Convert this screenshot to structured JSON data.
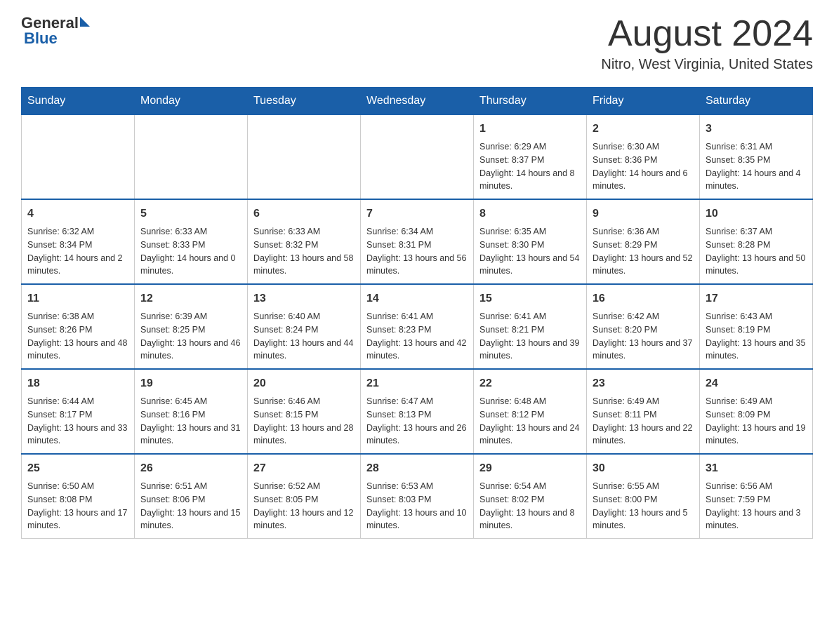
{
  "header": {
    "logo_general": "General",
    "logo_blue": "Blue",
    "month_title": "August 2024",
    "location": "Nitro, West Virginia, United States"
  },
  "weekdays": [
    "Sunday",
    "Monday",
    "Tuesday",
    "Wednesday",
    "Thursday",
    "Friday",
    "Saturday"
  ],
  "weeks": [
    [
      {
        "day": "",
        "info": ""
      },
      {
        "day": "",
        "info": ""
      },
      {
        "day": "",
        "info": ""
      },
      {
        "day": "",
        "info": ""
      },
      {
        "day": "1",
        "info": "Sunrise: 6:29 AM\nSunset: 8:37 PM\nDaylight: 14 hours and 8 minutes."
      },
      {
        "day": "2",
        "info": "Sunrise: 6:30 AM\nSunset: 8:36 PM\nDaylight: 14 hours and 6 minutes."
      },
      {
        "day": "3",
        "info": "Sunrise: 6:31 AM\nSunset: 8:35 PM\nDaylight: 14 hours and 4 minutes."
      }
    ],
    [
      {
        "day": "4",
        "info": "Sunrise: 6:32 AM\nSunset: 8:34 PM\nDaylight: 14 hours and 2 minutes."
      },
      {
        "day": "5",
        "info": "Sunrise: 6:33 AM\nSunset: 8:33 PM\nDaylight: 14 hours and 0 minutes."
      },
      {
        "day": "6",
        "info": "Sunrise: 6:33 AM\nSunset: 8:32 PM\nDaylight: 13 hours and 58 minutes."
      },
      {
        "day": "7",
        "info": "Sunrise: 6:34 AM\nSunset: 8:31 PM\nDaylight: 13 hours and 56 minutes."
      },
      {
        "day": "8",
        "info": "Sunrise: 6:35 AM\nSunset: 8:30 PM\nDaylight: 13 hours and 54 minutes."
      },
      {
        "day": "9",
        "info": "Sunrise: 6:36 AM\nSunset: 8:29 PM\nDaylight: 13 hours and 52 minutes."
      },
      {
        "day": "10",
        "info": "Sunrise: 6:37 AM\nSunset: 8:28 PM\nDaylight: 13 hours and 50 minutes."
      }
    ],
    [
      {
        "day": "11",
        "info": "Sunrise: 6:38 AM\nSunset: 8:26 PM\nDaylight: 13 hours and 48 minutes."
      },
      {
        "day": "12",
        "info": "Sunrise: 6:39 AM\nSunset: 8:25 PM\nDaylight: 13 hours and 46 minutes."
      },
      {
        "day": "13",
        "info": "Sunrise: 6:40 AM\nSunset: 8:24 PM\nDaylight: 13 hours and 44 minutes."
      },
      {
        "day": "14",
        "info": "Sunrise: 6:41 AM\nSunset: 8:23 PM\nDaylight: 13 hours and 42 minutes."
      },
      {
        "day": "15",
        "info": "Sunrise: 6:41 AM\nSunset: 8:21 PM\nDaylight: 13 hours and 39 minutes."
      },
      {
        "day": "16",
        "info": "Sunrise: 6:42 AM\nSunset: 8:20 PM\nDaylight: 13 hours and 37 minutes."
      },
      {
        "day": "17",
        "info": "Sunrise: 6:43 AM\nSunset: 8:19 PM\nDaylight: 13 hours and 35 minutes."
      }
    ],
    [
      {
        "day": "18",
        "info": "Sunrise: 6:44 AM\nSunset: 8:17 PM\nDaylight: 13 hours and 33 minutes."
      },
      {
        "day": "19",
        "info": "Sunrise: 6:45 AM\nSunset: 8:16 PM\nDaylight: 13 hours and 31 minutes."
      },
      {
        "day": "20",
        "info": "Sunrise: 6:46 AM\nSunset: 8:15 PM\nDaylight: 13 hours and 28 minutes."
      },
      {
        "day": "21",
        "info": "Sunrise: 6:47 AM\nSunset: 8:13 PM\nDaylight: 13 hours and 26 minutes."
      },
      {
        "day": "22",
        "info": "Sunrise: 6:48 AM\nSunset: 8:12 PM\nDaylight: 13 hours and 24 minutes."
      },
      {
        "day": "23",
        "info": "Sunrise: 6:49 AM\nSunset: 8:11 PM\nDaylight: 13 hours and 22 minutes."
      },
      {
        "day": "24",
        "info": "Sunrise: 6:49 AM\nSunset: 8:09 PM\nDaylight: 13 hours and 19 minutes."
      }
    ],
    [
      {
        "day": "25",
        "info": "Sunrise: 6:50 AM\nSunset: 8:08 PM\nDaylight: 13 hours and 17 minutes."
      },
      {
        "day": "26",
        "info": "Sunrise: 6:51 AM\nSunset: 8:06 PM\nDaylight: 13 hours and 15 minutes."
      },
      {
        "day": "27",
        "info": "Sunrise: 6:52 AM\nSunset: 8:05 PM\nDaylight: 13 hours and 12 minutes."
      },
      {
        "day": "28",
        "info": "Sunrise: 6:53 AM\nSunset: 8:03 PM\nDaylight: 13 hours and 10 minutes."
      },
      {
        "day": "29",
        "info": "Sunrise: 6:54 AM\nSunset: 8:02 PM\nDaylight: 13 hours and 8 minutes."
      },
      {
        "day": "30",
        "info": "Sunrise: 6:55 AM\nSunset: 8:00 PM\nDaylight: 13 hours and 5 minutes."
      },
      {
        "day": "31",
        "info": "Sunrise: 6:56 AM\nSunset: 7:59 PM\nDaylight: 13 hours and 3 minutes."
      }
    ]
  ]
}
